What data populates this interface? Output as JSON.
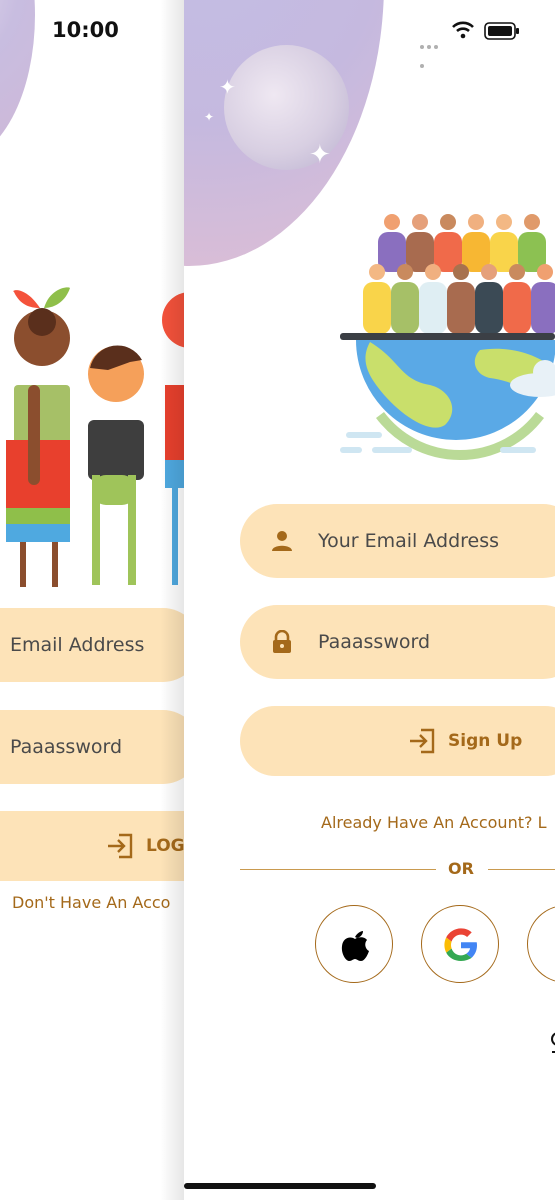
{
  "status": {
    "time": "10:00"
  },
  "back_screen": {
    "email_placeholder": "Email Address",
    "password_placeholder": "Paaassword",
    "login_label": "LOG",
    "dont_have_account": "Don't Have An Acco"
  },
  "front_screen": {
    "email_placeholder": "Your Email Address",
    "password_placeholder": "Paaassword",
    "signup_label": "Sign Up",
    "already_have_account": "Already Have An Account? L",
    "or_label": "OR",
    "social": [
      "apple-icon",
      "google-icon",
      "more-icon"
    ]
  },
  "colors": {
    "field_bg": "#fde3b8",
    "accent": "#a4691a"
  }
}
